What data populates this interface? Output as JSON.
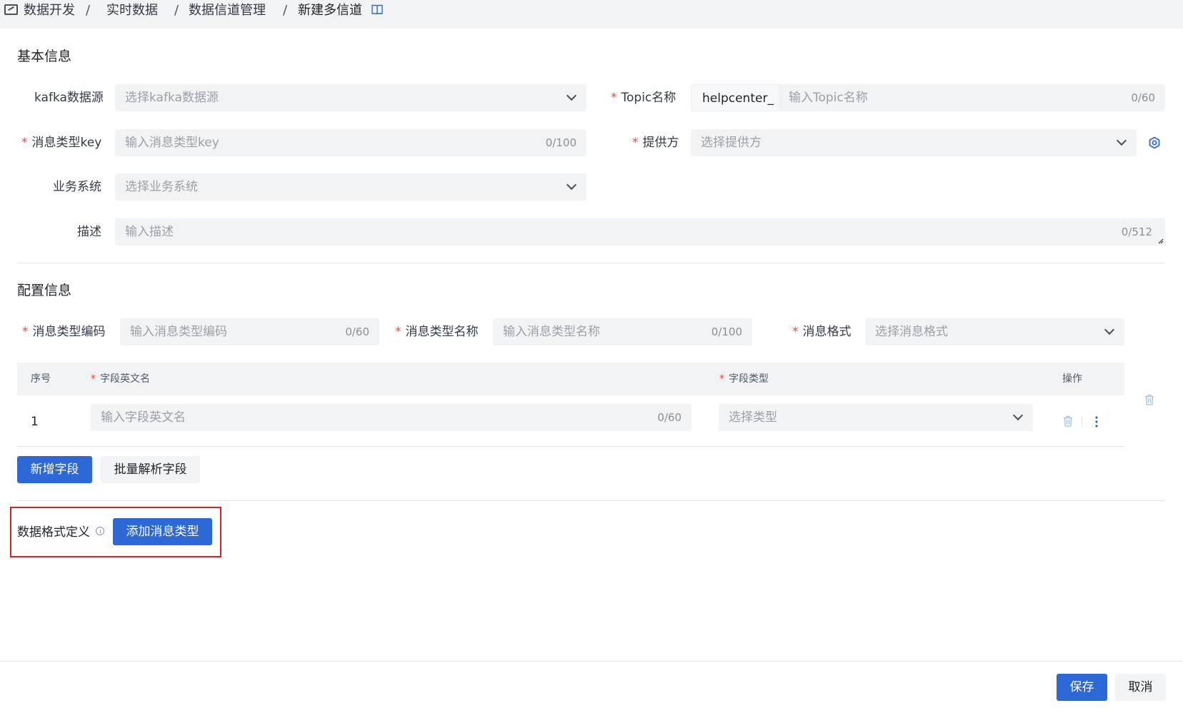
{
  "breadcrumb": {
    "items": [
      "数据开发",
      "实时数据",
      "数据信道管理",
      "新建多信道"
    ],
    "separator": "/"
  },
  "basic": {
    "title": "基本信息",
    "kafka": {
      "label": "kafka数据源",
      "placeholder": "选择kafka数据源"
    },
    "topic": {
      "label": "Topic名称",
      "prefix": "helpcenter_",
      "placeholder": "输入Topic名称",
      "count": "0/60"
    },
    "msg_key": {
      "label": "消息类型key",
      "placeholder": "输入消息类型key",
      "count": "0/100"
    },
    "provider": {
      "label": "提供方",
      "placeholder": "选择提供方"
    },
    "biz_system": {
      "label": "业务系统",
      "placeholder": "选择业务系统"
    },
    "desc": {
      "label": "描述",
      "placeholder": "输入描述",
      "count": "0/512"
    }
  },
  "config": {
    "title": "配置信息",
    "type_code": {
      "label": "消息类型编码",
      "placeholder": "输入消息类型编码",
      "count": "0/60"
    },
    "type_name": {
      "label": "消息类型名称",
      "placeholder": "输入消息类型名称",
      "count": "0/100"
    },
    "format": {
      "label": "消息格式",
      "placeholder": "选择消息格式"
    },
    "table": {
      "headers": {
        "index": "序号",
        "field_name": "字段英文名",
        "field_type": "字段类型",
        "ops": "操作"
      },
      "rows": [
        {
          "index": "1",
          "name_placeholder": "输入字段英文名",
          "name_count": "0/60",
          "type_placeholder": "选择类型"
        }
      ]
    },
    "add_field_button": "新增字段",
    "batch_parse_button": "批量解析字段"
  },
  "data_format": {
    "label": "数据格式定义",
    "add_type_button": "添加消息类型"
  },
  "footer": {
    "save_button": "保存",
    "cancel_button": "取消"
  },
  "colors": {
    "primary": "#2c68d6",
    "required": "#e5484d",
    "highlight": "#e02020",
    "field_bg": "#f2f3f5"
  }
}
